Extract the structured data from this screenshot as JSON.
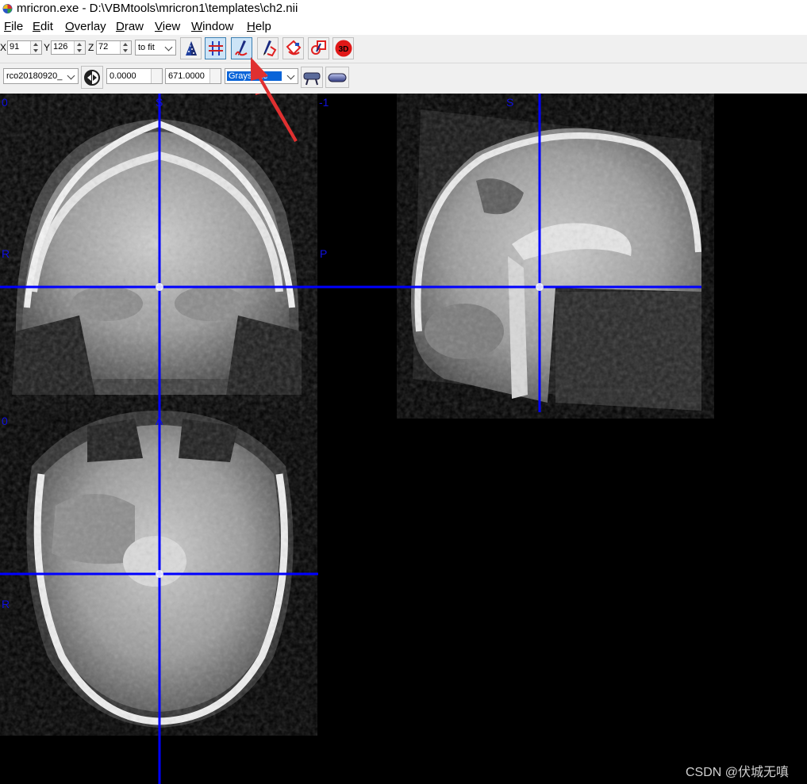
{
  "window": {
    "title": "mricron.exe - D:\\VBMtools\\mricron1\\templates\\ch2.nii"
  },
  "menu": [
    {
      "label": "File",
      "hotkey": "F",
      "rest": "ile"
    },
    {
      "label": "Edit",
      "hotkey": "E",
      "rest": "dit"
    },
    {
      "label": "Overlay",
      "hotkey": "O",
      "rest": "verlay"
    },
    {
      "label": "Draw",
      "hotkey": "D",
      "rest": "raw"
    },
    {
      "label": "View",
      "hotkey": "V",
      "rest": "iew"
    },
    {
      "label": "Window",
      "hotkey": "W",
      "rest": "indow"
    },
    {
      "label": "Help",
      "hotkey": "H",
      "rest": "elp"
    }
  ],
  "toolbar": {
    "x_label": "X",
    "x_value": "91",
    "y_label": "Y",
    "y_value": "126",
    "z_label": "Z",
    "z_value": "72",
    "zoom_value": "to fit",
    "buttons": [
      "3d-cone-icon",
      "crosshair-icon",
      "pen-draw-icon",
      "pen-erase-icon",
      "fill-icon",
      "eraser-3d-icon",
      "render-3d-icon"
    ],
    "render_3d_label": "3D",
    "active_button": "pen-draw-icon"
  },
  "toolbar2": {
    "layer_value": "rco20180920_",
    "min_value": "0.0000",
    "max_value": "671.0000",
    "colormap_value": "Grayscale"
  },
  "viewer": {
    "coronal_labels": {
      "top_left": "0",
      "top_center": "S",
      "left": "R"
    },
    "sagittal_labels": {
      "top_left": "-1",
      "top_center": "S",
      "left": "P"
    },
    "axial_labels": {
      "top_left": "0",
      "top_center": "A",
      "left": "R"
    },
    "crosshair_color": "#0000ff"
  },
  "watermark": "CSDN @伏城无嗔"
}
